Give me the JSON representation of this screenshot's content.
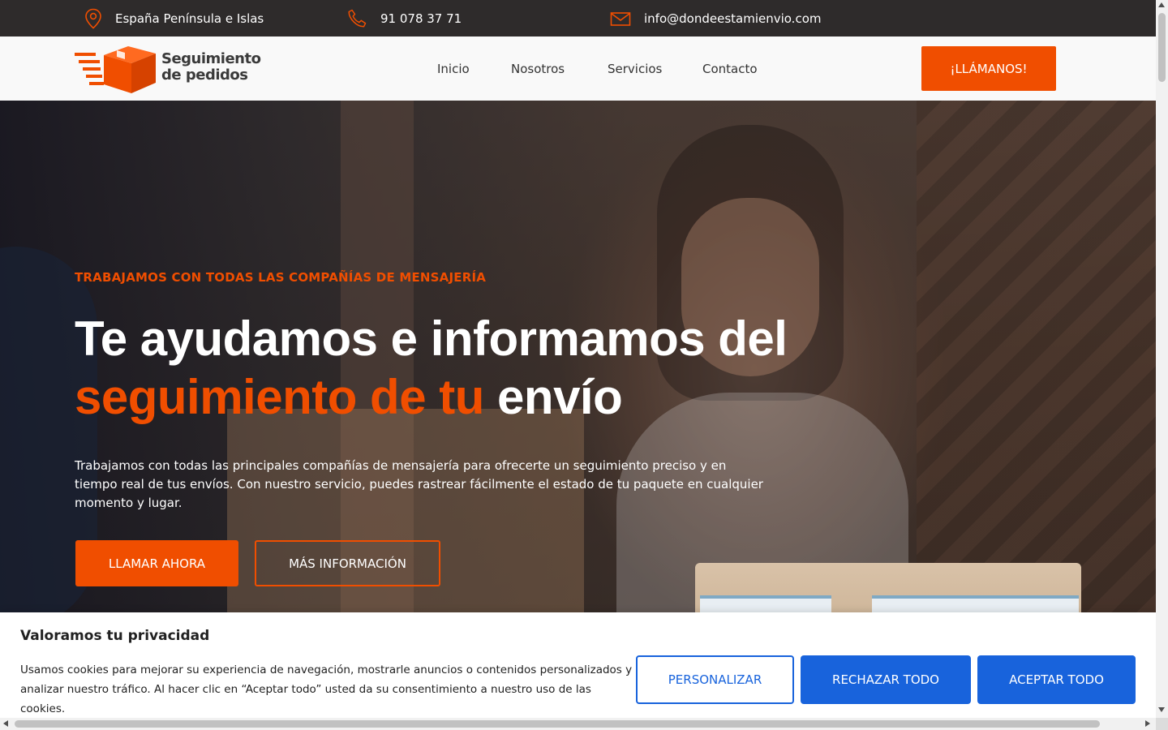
{
  "topbar": {
    "location": "España Península e Islas",
    "phone": "91 078 37 71",
    "email": "info@dondeestamienvio.com",
    "icons": [
      "map-pin-icon",
      "phone-icon",
      "mail-icon"
    ],
    "icon_color": "#f04e00",
    "background": "#2e2b2b"
  },
  "nav": {
    "logo_line1": "Seguimiento",
    "logo_line2": "de pedidos",
    "items": [
      {
        "label": "Inicio"
      },
      {
        "label": "Nosotros"
      },
      {
        "label": "Servicios"
      },
      {
        "label": "Contacto"
      }
    ],
    "cta_label": "¡LLÁMANOS!"
  },
  "hero": {
    "kicker": "TRABAJAMOS CON TODAS LAS COMPAÑÍAS DE MENSAJERÍA",
    "title_line1": "Te ayudamos e informamos del",
    "title_accent": "seguimiento de tu",
    "title_end": "envío",
    "lead": "Trabajamos con todas las principales compañías de mensajería para ofrecerte un seguimiento preciso y en tiempo real de tus envíos. Con nuestro servicio, puedes rastrear fácilmente el estado de tu paquete en cualquier momento y lugar.",
    "primary_button": "LLAMAR AHORA",
    "secondary_button": "MÁS INFORMACIÓN"
  },
  "cookie_banner": {
    "title": "Valoramos tu privacidad",
    "text": "Usamos cookies para mejorar su experiencia de navegación, mostrarle anuncios o contenidos personalizados y analizar nuestro tráfico. Al hacer clic en “Aceptar todo” usted da su consentimiento a nuestro uso de las cookies.",
    "customize_label": "PERSONALIZAR",
    "reject_label": "RECHAZAR TODO",
    "accept_label": "ACEPTAR TODO",
    "button_color": "#1863dc"
  },
  "colors": {
    "accent": "#f04e00"
  }
}
